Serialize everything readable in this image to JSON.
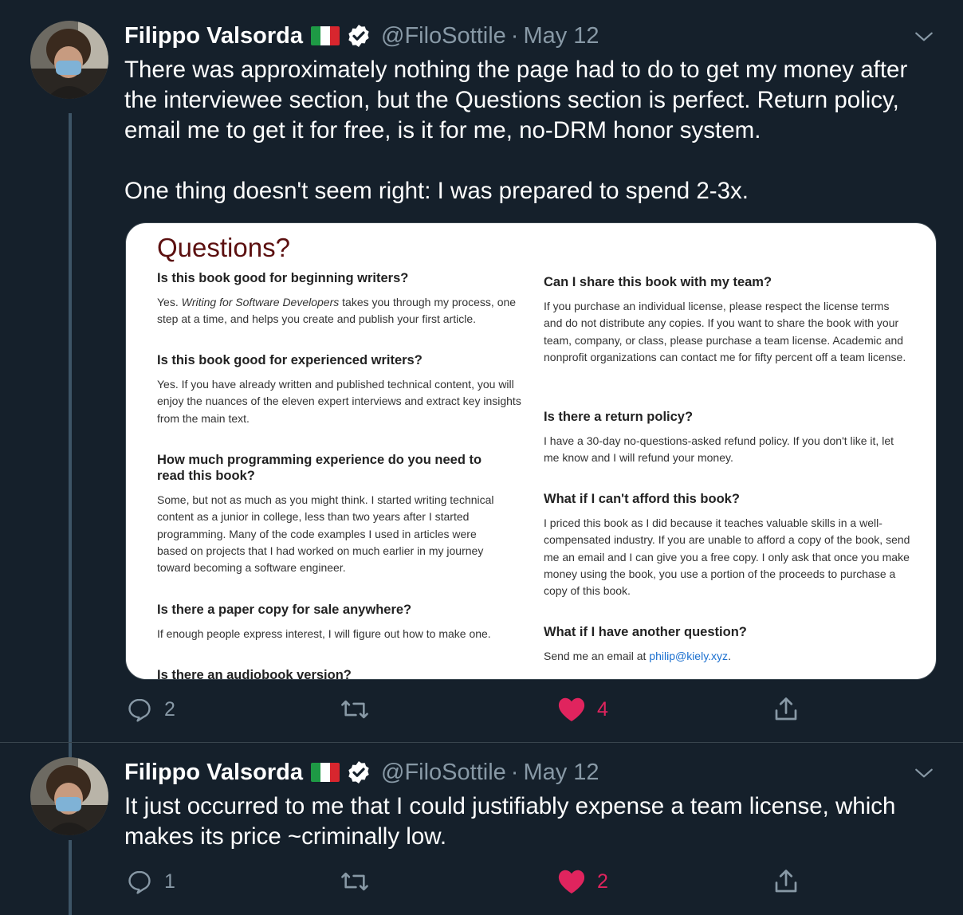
{
  "tweets": [
    {
      "author_name": "Filippo Valsorda",
      "handle": "@FiloSottile",
      "separator": "·",
      "date": "May 12",
      "text": "There was approximately nothing the page had to do to get my money after the interviewee section, but the Questions section is perfect. Return policy, email me to get it for free, is it for me, no-DRM honor system.\n\nOne thing doesn't seem right: I was prepared to spend 2-3x.",
      "replies": "2",
      "retweets": "",
      "likes": "4",
      "liked": true
    },
    {
      "author_name": "Filippo Valsorda",
      "handle": "@FiloSottile",
      "separator": "·",
      "date": "May 12",
      "text": "It just occurred to me that I could justifiably expense a team license, which makes its price ~criminally low.",
      "replies": "1",
      "retweets": "",
      "likes": "2",
      "liked": true
    }
  ],
  "card": {
    "title": "Questions?",
    "left": [
      {
        "q": "Is this book good for beginning writers?",
        "a_prefix": "Yes. ",
        "a_em": "Writing for Software Developers",
        "a_rest": " takes you through my process, one step at a time, and helps you create and publish your first article."
      },
      {
        "q": "Is this book good for experienced writers?",
        "a": "Yes. If you have already written and published technical content, you will enjoy the nuances of the eleven expert interviews and extract key insights from the main text."
      },
      {
        "q": "How much programming experience do you need to read this book?",
        "a": "Some, but not as much as you might think. I started writing technical content as a junior in college, less than two years after I started programming. Many of the code examples I used in articles were based on projects that I had worked on much earlier in my journey toward becoming a software engineer."
      },
      {
        "q": "Is there a paper copy for sale anywhere?",
        "a": "If enough people express interest, I will figure out how to make one."
      },
      {
        "q": "Is there an audiobook version?"
      }
    ],
    "right": [
      {
        "q": "Can I share this book with my team?",
        "a": "If you purchase an individual license, please respect the license terms and do not distribute any copies. If you want to share the book with your team, company, or class, please purchase a team license. Academic and nonprofit organizations can contact me for fifty percent off a team license."
      },
      {
        "q": "Is there a return policy?",
        "a": "I have a 30-day no-questions-asked refund policy. If you don't like it, let me know and I will refund your money."
      },
      {
        "q": "What if I can't afford this book?",
        "a": "I priced this book as I did because it teaches valuable skills in a well-compensated industry. If you are unable to afford a copy of the book, send me an email and I can give you a free copy. I only ask that once you make money using the book, you use a portion of the proceeds to purchase a copy of this book."
      },
      {
        "q": "What if I have another question?",
        "a_prefix": "Send me an email at ",
        "a_link": "philip@kiely.xyz",
        "a_suffix": "."
      }
    ]
  },
  "colors": {
    "background": "#15202b",
    "secondary_text": "#8899a6",
    "like": "#e0245e",
    "verified": "#ffffff",
    "card_title": "#5c1010",
    "link": "#1a6fcf"
  },
  "icons": [
    "avatar",
    "italy-flag-icon",
    "verified-badge-icon",
    "chevron-down-icon",
    "reply-icon",
    "retweet-icon",
    "heart-icon",
    "share-icon"
  ]
}
